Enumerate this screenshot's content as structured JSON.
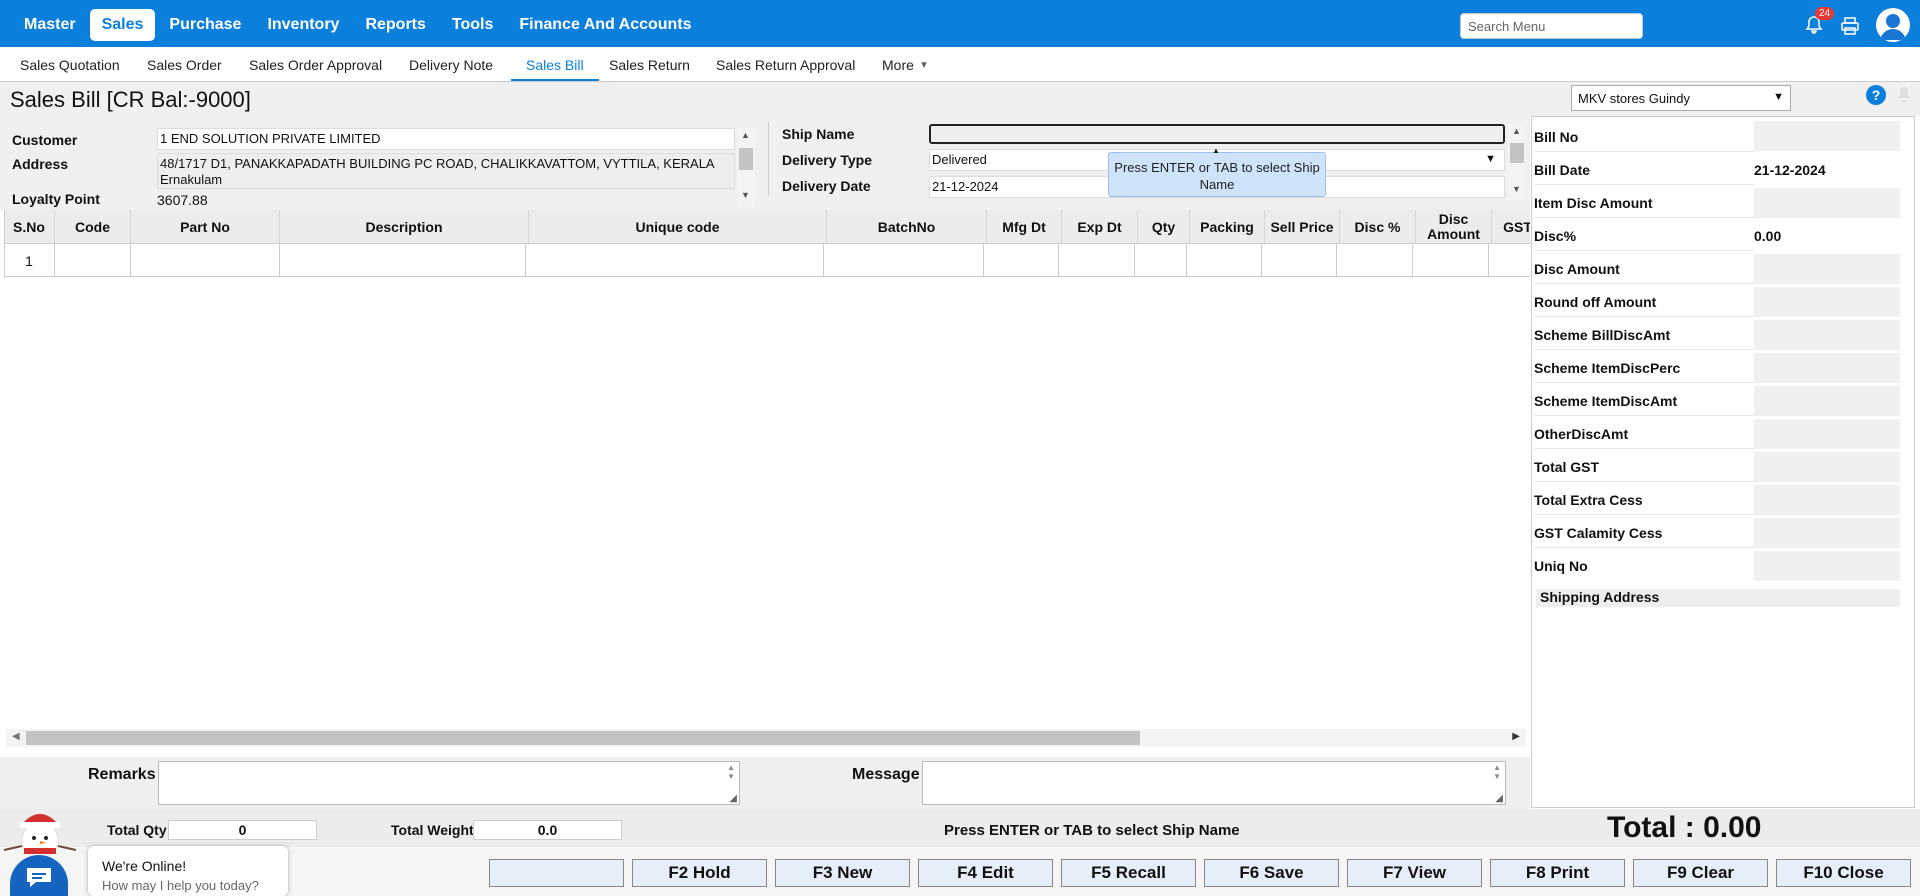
{
  "topnav": {
    "items": [
      "Master",
      "Sales",
      "Purchase",
      "Inventory",
      "Reports",
      "Tools",
      "Finance And Accounts"
    ],
    "active_index": 1,
    "search_placeholder": "Search Menu",
    "notification_count": "24"
  },
  "subnav": {
    "items": [
      "Sales Quotation",
      "Sales Order",
      "Sales Order Approval",
      "Delivery Note",
      "Sales Bill",
      "Sales Return",
      "Sales Return Approval",
      "More"
    ],
    "active_index": 4
  },
  "page": {
    "title": "Sales Bill [CR Bal:-9000]",
    "store": "MKV stores Guindy"
  },
  "customer": {
    "customer_label": "Customer",
    "customer_value": "1 END SOLUTION PRIVATE LIMITED",
    "address_label": "Address",
    "address_value": "48/1717 D1, PANAKKAPADATH BUILDING PC ROAD, CHALIKKAVATTOM, VYTTILA, KERALA Ernakulam",
    "loyalty_label": "Loyalty Point",
    "loyalty_value": "3607.88"
  },
  "shipping": {
    "ship_name_label": "Ship Name",
    "ship_name_value": "",
    "delivery_type_label": "Delivery Type",
    "delivery_type_value": "Delivered",
    "delivery_date_label": "Delivery Date",
    "delivery_date_value": "21-12-2024",
    "tooltip": "Press ENTER or TAB to select Ship Name"
  },
  "grid": {
    "columns": [
      "S.No",
      "Code",
      "Part No",
      "Description",
      "Unique code",
      "BatchNo",
      "Mfg Dt",
      "Exp Dt",
      "Qty",
      "Packing",
      "Sell Price",
      "Disc %",
      "Disc Amount",
      "GST"
    ],
    "rows": [
      [
        "1",
        "",
        "",
        "",
        "",
        "",
        "",
        "",
        "",
        "",
        "",
        "",
        "",
        ""
      ]
    ]
  },
  "summary": [
    {
      "label": "Bill No",
      "value": ""
    },
    {
      "label": "Bill Date",
      "value": "21-12-2024"
    },
    {
      "label": "Item Disc Amount",
      "value": ""
    },
    {
      "label": "Disc%",
      "value": "0.00"
    },
    {
      "label": "Disc Amount",
      "value": ""
    },
    {
      "label": "Round off Amount",
      "value": ""
    },
    {
      "label": "Scheme BillDiscAmt",
      "value": ""
    },
    {
      "label": "Scheme ItemDiscPerc",
      "value": ""
    },
    {
      "label": "Scheme ItemDiscAmt",
      "value": ""
    },
    {
      "label": "OtherDiscAmt",
      "value": ""
    },
    {
      "label": "Total GST",
      "value": ""
    },
    {
      "label": "Total Extra Cess",
      "value": ""
    },
    {
      "label": "GST Calamity Cess",
      "value": ""
    },
    {
      "label": "Uniq No",
      "value": ""
    }
  ],
  "shipping_address_label": "Shipping Address",
  "footer": {
    "remarks_label": "Remarks",
    "message_label": "Message",
    "total_qty_label": "Total Qty",
    "total_qty_value": "0",
    "total_weight_label": "Total Weight",
    "total_weight_value": "0.0",
    "status_message": "Press ENTER or TAB to select Ship Name",
    "total_label": "Total : 0.00"
  },
  "buttons": [
    "",
    "F2 Hold",
    "F3 New",
    "F4 Edit",
    "F5 Recall",
    "F6 Save",
    "F7 View",
    "F8 Print",
    "F9 Clear",
    "F10 Close"
  ],
  "chat": {
    "title": "We're Online!",
    "subtitle": "How may I help you today?"
  }
}
